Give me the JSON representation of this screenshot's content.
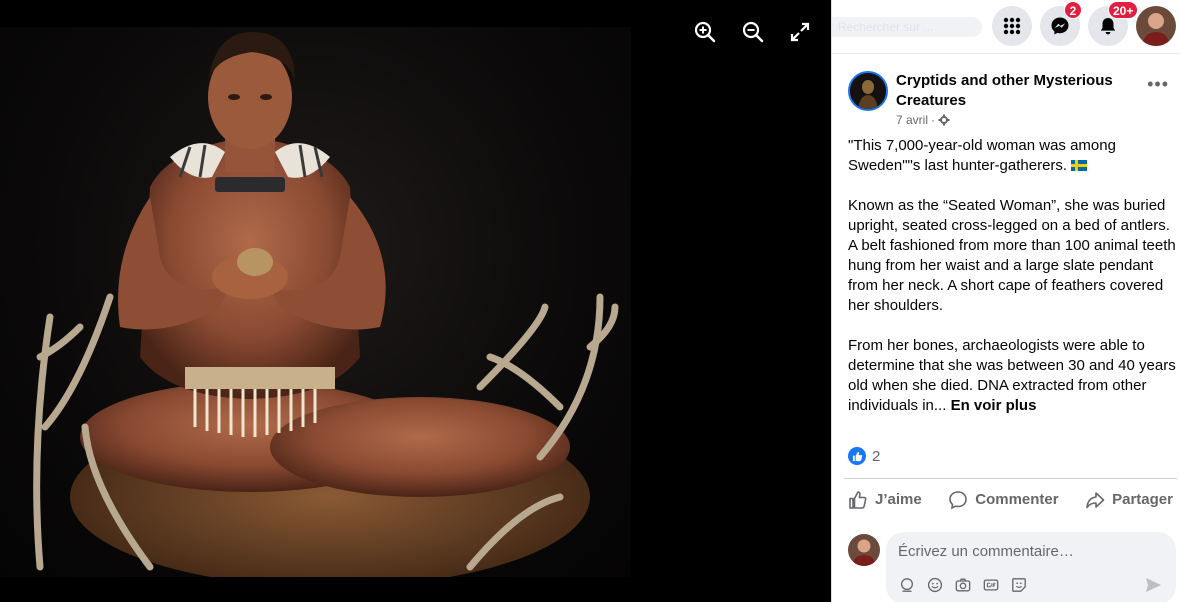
{
  "viewer": {
    "zoom_in_icon": "zoom-in-icon",
    "zoom_out_icon": "zoom-out-icon",
    "fullscreen_icon": "expand-icon"
  },
  "topbar": {
    "search_ghost": "Rechercher sur ...",
    "messenger_badge": "2",
    "notifications_badge": "20+"
  },
  "post": {
    "page_name": "Cryptids and other Mysterious Creatures",
    "date": "7 avril",
    "paragraph1": "\"This 7,000-year-old woman was among Sweden\"\"s last hunter-gatherers.",
    "paragraph2": "Known as the “Seated Woman”, she was buried upright, seated cross-legged on a bed of antlers. A belt fashioned from more than 100 animal teeth hung from her waist and a large slate pendant from her neck. A short cape of feathers covered her shoulders.",
    "paragraph3": "From her bones, archaeologists were able to determine that she was between 30 and 40 years old when she died. DNA extracted from other individuals in...",
    "see_more": "En voir plus",
    "like_count": "2"
  },
  "actions": {
    "like": "J’aime",
    "comment": "Commenter",
    "share": "Partager"
  },
  "comment": {
    "placeholder": "Écrivez un commentaire…"
  },
  "colors": {
    "accent": "#1877f2",
    "badge": "#e41e3f"
  }
}
